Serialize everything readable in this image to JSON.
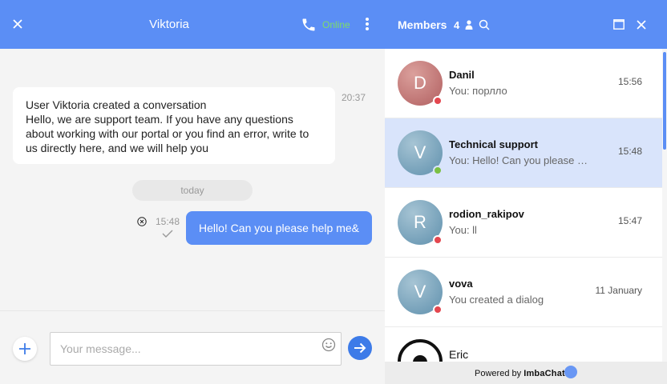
{
  "chat": {
    "title": "Viktoria",
    "status": "Online",
    "messages": [
      {
        "lines": [
          "User Viktoria created a conversation",
          "Hello, we are support team. If you have any questions",
          "about working with our portal or you find an error, write to",
          "us directly here, and we will help you"
        ],
        "time": "20:37"
      }
    ],
    "day_separator": "today",
    "outgoing": {
      "text": "Hello! Can you please help me&",
      "time": "15:48"
    },
    "composer": {
      "placeholder": "Your message..."
    }
  },
  "members": {
    "title": "Members",
    "count": "4",
    "items": [
      {
        "initial": "D",
        "name": "Danil",
        "preview": "You: порлло",
        "time": "15:56",
        "status": "offline",
        "avatar_color": "#c0706f"
      },
      {
        "initial": "V",
        "name": "Technical support",
        "preview": "You: Hello! Can you please help me&",
        "time": "15:48",
        "status": "online",
        "avatar_color": "#6d9db8"
      },
      {
        "initial": "R",
        "name": "rodion_rakipov",
        "preview": "You: ll",
        "time": "15:47",
        "status": "offline",
        "avatar_color": "#6d9db8"
      },
      {
        "initial": "V",
        "name": "vova",
        "preview": "You created a dialog",
        "time": "11 January",
        "status": "offline",
        "avatar_color": "#6d9db8"
      },
      {
        "name": "Eric"
      }
    ]
  },
  "footer": {
    "powered_by": "Powered by",
    "brand": "ImbaChat"
  },
  "colors": {
    "header": "#5b8ef5",
    "online": "#7ddc6a",
    "offline": "#e4474f",
    "selected": "#d9e4fb"
  },
  "icons": [
    "close-icon",
    "phone-icon",
    "more-vert-icon",
    "cancel-icon",
    "check-icon",
    "plus-icon",
    "emoji-icon",
    "send-arrow-icon",
    "user-icon",
    "search-icon",
    "maximize-icon"
  ]
}
